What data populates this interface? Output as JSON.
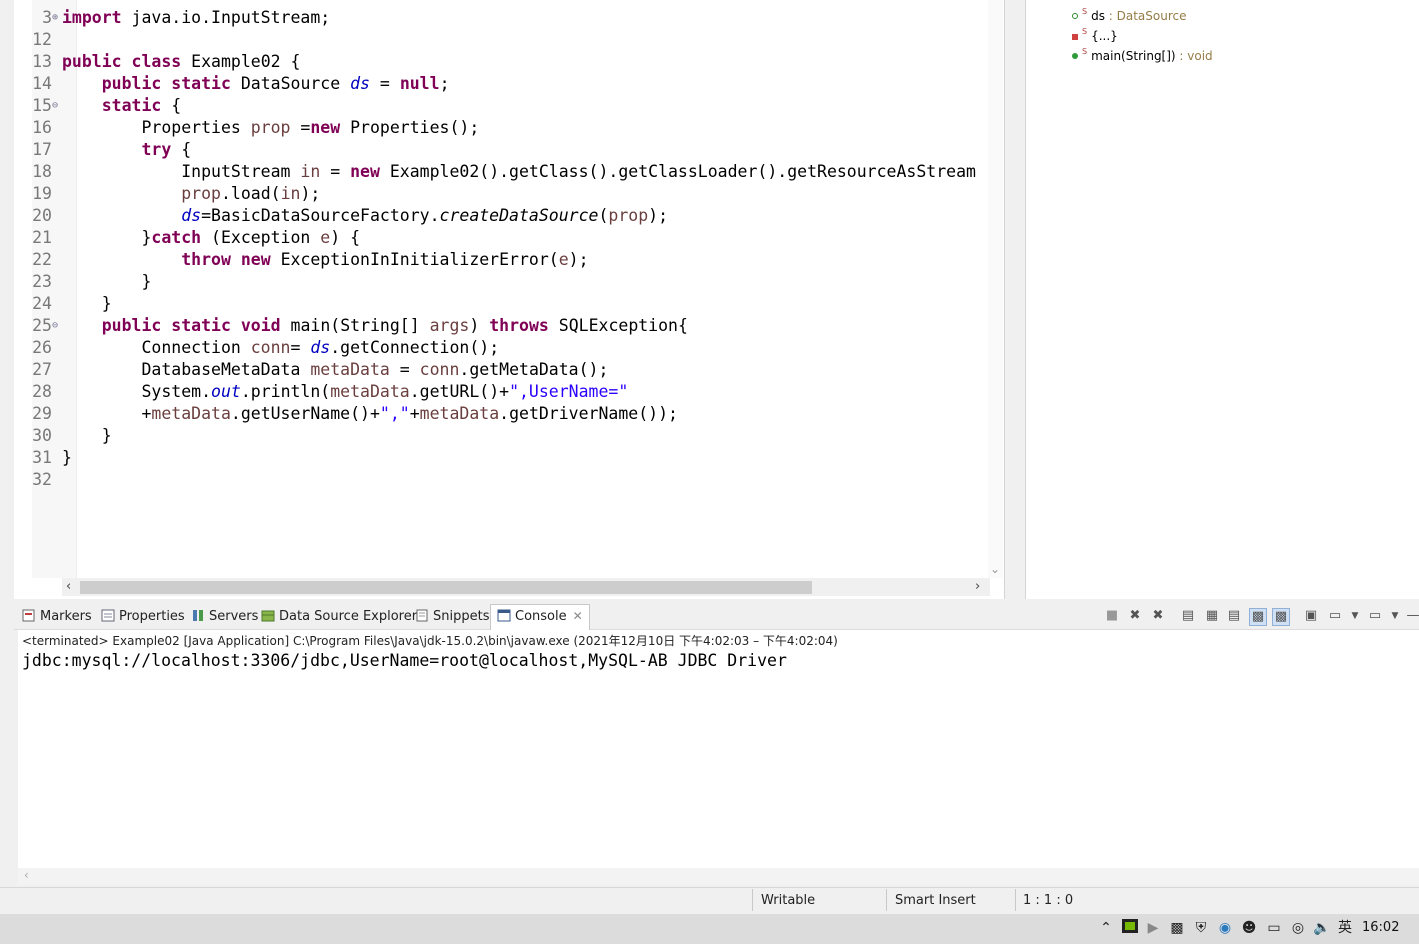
{
  "editor": {
    "lines": [
      {
        "n": "3",
        "fold": "+",
        "tokens": [
          [
            "kw",
            "import"
          ],
          [
            "tx",
            " java.io.InputStream;"
          ]
        ]
      },
      {
        "n": "12",
        "tokens": []
      },
      {
        "n": "13",
        "tokens": [
          [
            "kw",
            "public"
          ],
          [
            "tx",
            " "
          ],
          [
            "kw",
            "class"
          ],
          [
            "tx",
            " Example02 {"
          ]
        ]
      },
      {
        "n": "14",
        "tokens": [
          [
            "tx",
            "    "
          ],
          [
            "kw",
            "public"
          ],
          [
            "tx",
            " "
          ],
          [
            "kw",
            "static"
          ],
          [
            "tx",
            " DataSource "
          ],
          [
            "fld",
            "ds"
          ],
          [
            "tx",
            " = "
          ],
          [
            "kw",
            "null"
          ],
          [
            "tx",
            ";"
          ]
        ]
      },
      {
        "n": "15",
        "fold": "-",
        "tokens": [
          [
            "tx",
            "    "
          ],
          [
            "kw",
            "static"
          ],
          [
            "tx",
            " {"
          ]
        ]
      },
      {
        "n": "16",
        "tokens": [
          [
            "tx",
            "        Properties "
          ],
          [
            "loc",
            "prop"
          ],
          [
            "tx",
            " ="
          ],
          [
            "kw",
            "new"
          ],
          [
            "tx",
            " Properties();"
          ]
        ]
      },
      {
        "n": "17",
        "tokens": [
          [
            "tx",
            "        "
          ],
          [
            "kw",
            "try"
          ],
          [
            "tx",
            " {"
          ]
        ]
      },
      {
        "n": "18",
        "tokens": [
          [
            "tx",
            "            InputStream "
          ],
          [
            "loc",
            "in"
          ],
          [
            "tx",
            " = "
          ],
          [
            "kw",
            "new"
          ],
          [
            "tx",
            " Example02().getClass().getClassLoader().getResourceAsStream"
          ]
        ]
      },
      {
        "n": "19",
        "tokens": [
          [
            "tx",
            "            "
          ],
          [
            "loc",
            "prop"
          ],
          [
            "tx",
            ".load("
          ],
          [
            "loc",
            "in"
          ],
          [
            "tx",
            ");"
          ]
        ]
      },
      {
        "n": "20",
        "tokens": [
          [
            "tx",
            "            "
          ],
          [
            "fld",
            "ds"
          ],
          [
            "tx",
            "=BasicDataSourceFactory."
          ],
          [
            "ital",
            "createDataSource"
          ],
          [
            "tx",
            "("
          ],
          [
            "loc",
            "prop"
          ],
          [
            "tx",
            ");"
          ]
        ]
      },
      {
        "n": "21",
        "tokens": [
          [
            "tx",
            "        }"
          ],
          [
            "kw",
            "catch"
          ],
          [
            "tx",
            " (Exception "
          ],
          [
            "loc",
            "e"
          ],
          [
            "tx",
            ") {"
          ]
        ]
      },
      {
        "n": "22",
        "tokens": [
          [
            "tx",
            "            "
          ],
          [
            "kw",
            "throw"
          ],
          [
            "tx",
            " "
          ],
          [
            "kw",
            "new"
          ],
          [
            "tx",
            " ExceptionInInitializerError("
          ],
          [
            "loc",
            "e"
          ],
          [
            "tx",
            ");"
          ]
        ]
      },
      {
        "n": "23",
        "tokens": [
          [
            "tx",
            "        }"
          ]
        ]
      },
      {
        "n": "24",
        "tokens": [
          [
            "tx",
            "    }"
          ]
        ]
      },
      {
        "n": "25",
        "fold": "-",
        "tokens": [
          [
            "tx",
            "    "
          ],
          [
            "kw",
            "public"
          ],
          [
            "tx",
            " "
          ],
          [
            "kw",
            "static"
          ],
          [
            "tx",
            " "
          ],
          [
            "kw",
            "void"
          ],
          [
            "tx",
            " main(String[] "
          ],
          [
            "loc",
            "args"
          ],
          [
            "tx",
            ") "
          ],
          [
            "kw",
            "throws"
          ],
          [
            "tx",
            " SQLException{"
          ]
        ]
      },
      {
        "n": "26",
        "tokens": [
          [
            "tx",
            "        Connection "
          ],
          [
            "loc",
            "conn"
          ],
          [
            "tx",
            "= "
          ],
          [
            "fld",
            "ds"
          ],
          [
            "tx",
            ".getConnection();"
          ]
        ]
      },
      {
        "n": "27",
        "tokens": [
          [
            "tx",
            "        DatabaseMetaData "
          ],
          [
            "loc",
            "metaData"
          ],
          [
            "tx",
            " = "
          ],
          [
            "loc",
            "conn"
          ],
          [
            "tx",
            ".getMetaData();"
          ]
        ]
      },
      {
        "n": "28",
        "tokens": [
          [
            "tx",
            "        System."
          ],
          [
            "fld",
            "out"
          ],
          [
            "tx",
            ".println("
          ],
          [
            "loc",
            "metaData"
          ],
          [
            "tx",
            ".getURL()+"
          ],
          [
            "str",
            "\",UserName=\""
          ]
        ]
      },
      {
        "n": "29",
        "tokens": [
          [
            "tx",
            "        +"
          ],
          [
            "loc",
            "metaData"
          ],
          [
            "tx",
            ".getUserName()+"
          ],
          [
            "str",
            "\",\""
          ],
          [
            "tx",
            "+"
          ],
          [
            "loc",
            "metaData"
          ],
          [
            "tx",
            ".getDriverName());"
          ]
        ]
      },
      {
        "n": "30",
        "tokens": [
          [
            "tx",
            "    }"
          ]
        ]
      },
      {
        "n": "31",
        "tokens": [
          [
            "tx",
            "}"
          ]
        ]
      },
      {
        "n": "32",
        "tokens": []
      }
    ]
  },
  "outline": {
    "items": [
      {
        "name": "ds",
        "type": " : DataSource",
        "marker": "dot-hollow-green"
      },
      {
        "name": "{...}",
        "type": "",
        "marker": "square-red"
      },
      {
        "name": "main(String[])",
        "type": " : void",
        "marker": "dot-green"
      }
    ]
  },
  "console": {
    "tabs": [
      {
        "label": "Markers",
        "icon": "markers-icon"
      },
      {
        "label": "Properties",
        "icon": "properties-icon"
      },
      {
        "label": "Servers",
        "icon": "servers-icon"
      },
      {
        "label": "Data Source Explorer",
        "icon": "data-source-explorer-icon"
      },
      {
        "label": "Snippets",
        "icon": "snippets-icon"
      },
      {
        "label": "Console",
        "icon": "console-icon"
      }
    ],
    "terminated": "<terminated> Example02 [Java Application] C:\\Program Files\\Java\\jdk-15.0.2\\bin\\javaw.exe  (2021年12月10日 下午4:02:03 – 下午4:02:04)",
    "output": "jdbc:mysql://localhost:3306/jdbc,UserName=root@localhost,MySQL-AB JDBC Driver"
  },
  "status": {
    "writable": "Writable",
    "insert_mode": "Smart Insert",
    "position": "1 : 1 : 0"
  },
  "taskbar": {
    "ime": "英",
    "time": "16:02"
  },
  "colors": {
    "keyword": "#7f0055",
    "field": "#0000c0",
    "local_var": "#6a3e3e",
    "string": "#2a00ff",
    "outline_type": "#957d47"
  }
}
